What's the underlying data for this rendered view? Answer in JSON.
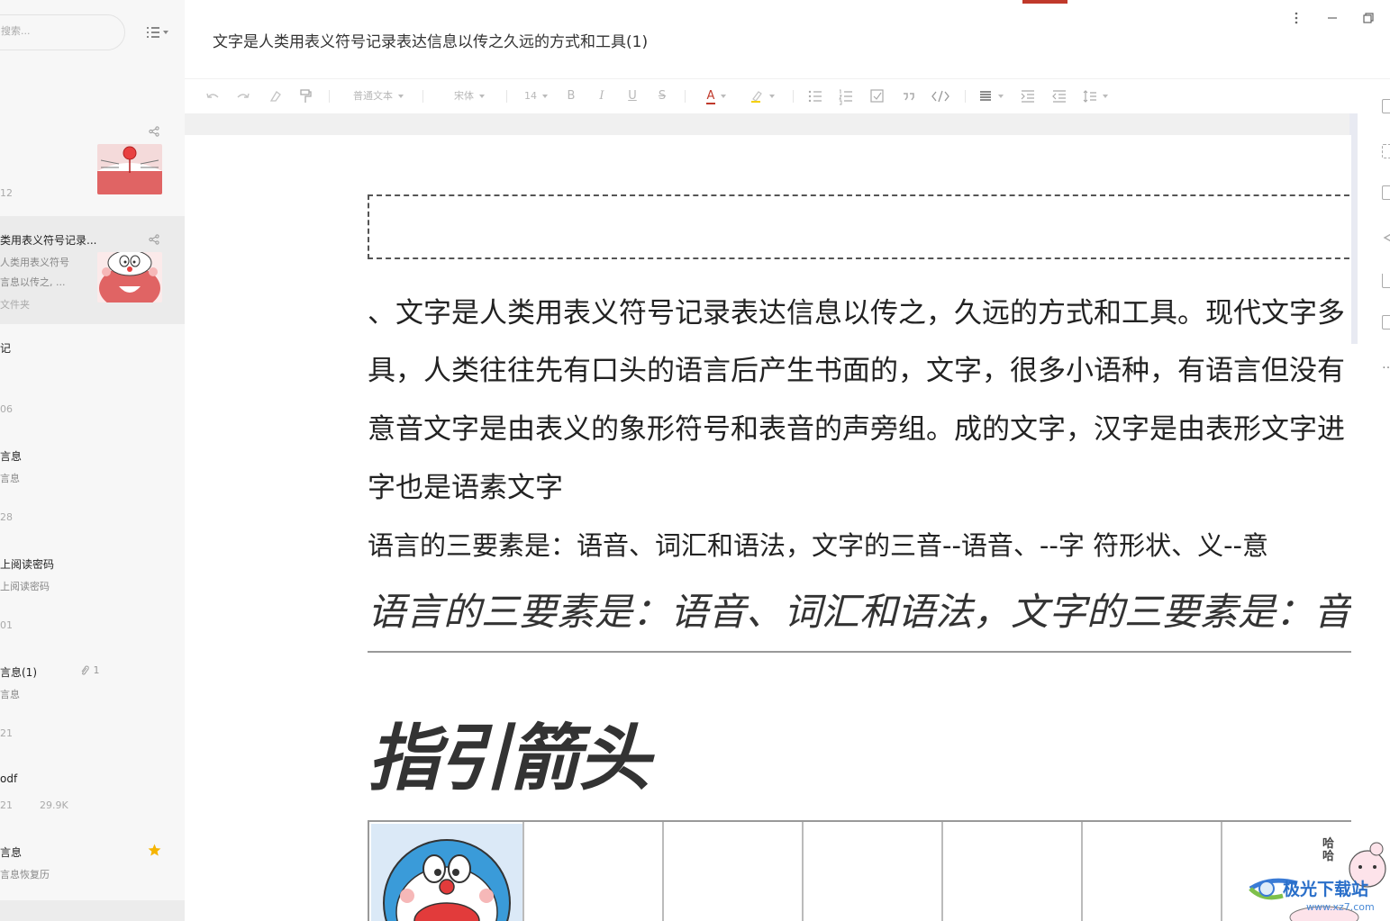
{
  "search": {
    "placeholder": "搜索..."
  },
  "notes": [
    {
      "title": "",
      "snippet1": "",
      "snippet2": "",
      "meta": "12"
    },
    {
      "title": "类用表义符号记录...",
      "snippet1": "人类用表义符号",
      "snippet2": "言息以传之, ...",
      "meta": "文件夹"
    },
    {
      "title": "记",
      "meta": "06"
    },
    {
      "title": "言息",
      "snippet1": "言息",
      "meta": "28"
    },
    {
      "title": "上阅读密码",
      "snippet1": "上阅读密码",
      "meta": "01"
    },
    {
      "title": "言息(1)",
      "snippet1": "言息",
      "meta": "21",
      "attachments": "1"
    },
    {
      "title": "odf",
      "meta": "21",
      "size": "29.9K"
    },
    {
      "title": "言息",
      "snippet1": "言息恢复历"
    }
  ],
  "document": {
    "title": "文字是人类用表义符号记录表达信息以传之久远的方式和工具(1)"
  },
  "toolbar": {
    "paragraph_style": "普通文本",
    "font_family": "宋体",
    "font_size": "14",
    "bold": "B",
    "italic": "I",
    "underline": "U",
    "strike": "S",
    "font_color": "A"
  },
  "content": {
    "para1": "、文字是人类用表义符号记录表达信息以传之，久远的方式和工具。现代文字多",
    "para2": "具，人类往往先有口头的语言后产生书面的，文字，很多小语种，有语言但没有",
    "para3": "意音文字是由表义的象形符号和表音的声旁组。成的文字，汉字是由表形文字进",
    "para4": "字也是语素文字",
    "para5": "语言的三要素是：语音、词汇和语法，文字的三音--语音、--字 符形状、义--意",
    "para6": "语言的三要素是：语音、词汇和语法，文字的三要素是：音",
    "heading": "指引箭头"
  },
  "watermark": {
    "brand": "极光下载站",
    "domain": "www.xz7.com",
    "sticker_text": "哈哈"
  },
  "colors": {
    "accent_red": "#c0392b",
    "star": "#f5b400",
    "sidebar_bg": "#f7f7f7"
  }
}
